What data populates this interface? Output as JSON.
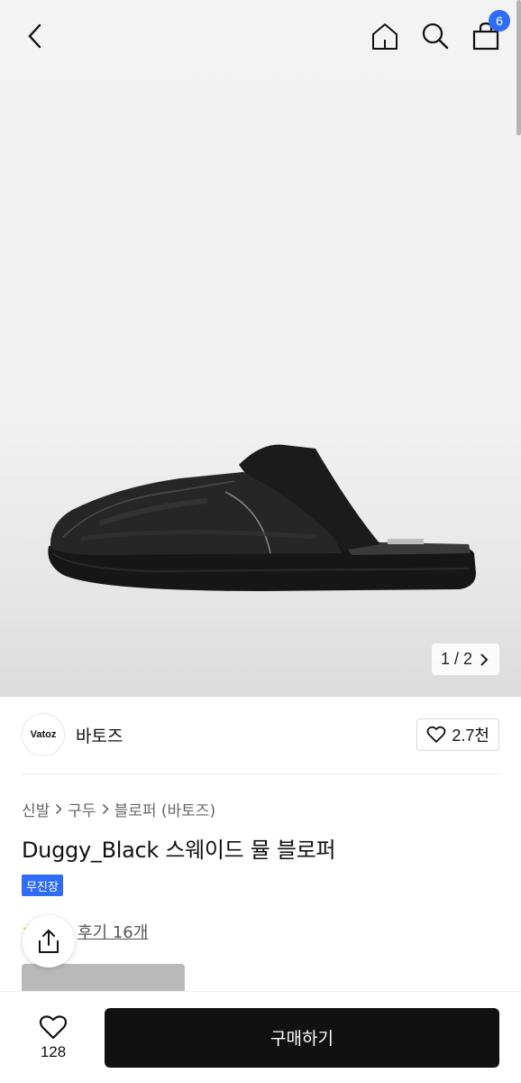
{
  "header": {
    "cart_count": "6"
  },
  "gallery": {
    "pager_text": "1 / 2"
  },
  "brand": {
    "logo_text": "Vatoz",
    "name": "바토즈",
    "like_count": "2.7천"
  },
  "breadcrumb": [
    "신발",
    "구두",
    "블로퍼 (바토즈)"
  ],
  "product": {
    "title": "Duggy_Black 스웨이드 뮬 블로퍼",
    "badge": "무진장",
    "reviews": "후기 16개"
  },
  "bottom": {
    "wish_count": "128",
    "buy_label": "구매하기"
  },
  "colors": {
    "accent": "#2f6df6",
    "buy_button": "#111111"
  },
  "icons": [
    "back-icon",
    "home-icon",
    "search-icon",
    "bag-icon",
    "chevron-right-icon",
    "heart-icon",
    "share-icon",
    "star-icon"
  ]
}
